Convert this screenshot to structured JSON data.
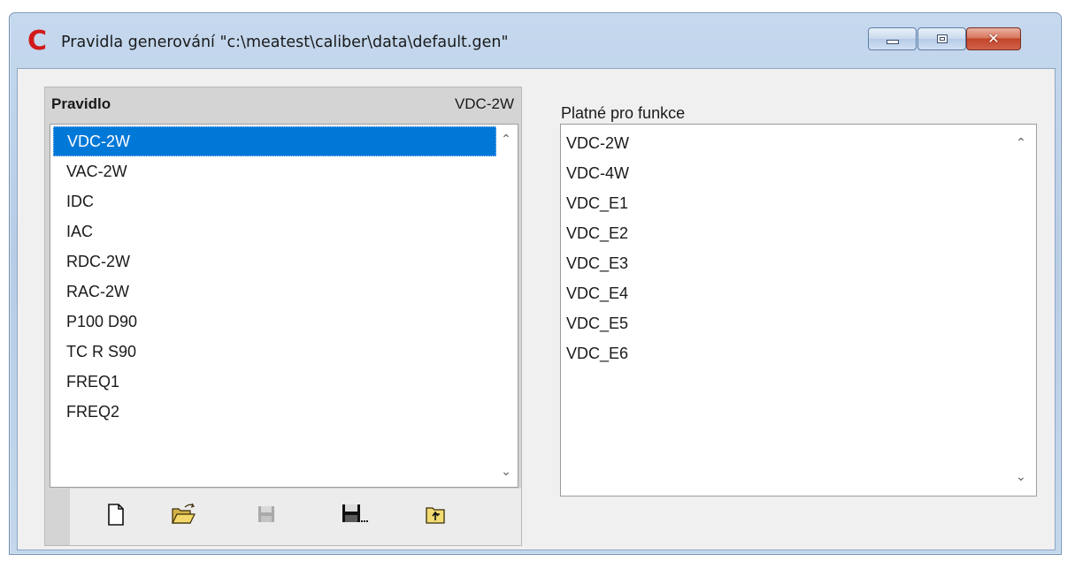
{
  "window": {
    "title": "Pravidla generování \"c:\\meatest\\caliber\\data\\default.gen\"",
    "app_icon_glyph": "C",
    "app_icon_color": "#d21a1a",
    "close_glyph": "✕"
  },
  "left_panel": {
    "header_label": "Pravidlo",
    "header_value": "VDC-2W",
    "items": [
      {
        "label": "VDC-2W",
        "selected": true
      },
      {
        "label": "VAC-2W",
        "selected": false
      },
      {
        "label": "IDC",
        "selected": false
      },
      {
        "label": "IAC",
        "selected": false
      },
      {
        "label": "RDC-2W",
        "selected": false
      },
      {
        "label": "RAC-2W",
        "selected": false
      },
      {
        "label": "P100 D90",
        "selected": false
      },
      {
        "label": "TC R S90",
        "selected": false
      },
      {
        "label": "FREQ1",
        "selected": false
      },
      {
        "label": "FREQ2",
        "selected": false
      }
    ],
    "selection_color": "#0078d7",
    "toolbar": [
      {
        "icon": "new-file-icon",
        "enabled": true
      },
      {
        "icon": "open-folder-icon",
        "enabled": true
      },
      {
        "icon": "save-icon",
        "enabled": false
      },
      {
        "icon": "save-as-icon",
        "enabled": true
      },
      {
        "icon": "import-icon",
        "enabled": true
      }
    ]
  },
  "right_panel": {
    "label": "Platné pro funkce",
    "items": [
      "VDC-2W",
      "VDC-4W",
      "VDC_E1",
      "VDC_E2",
      "VDC_E3",
      "VDC_E4",
      "VDC_E5",
      "VDC_E6"
    ]
  },
  "scroll": {
    "up_glyph": "⌃",
    "down_glyph": "⌄"
  }
}
